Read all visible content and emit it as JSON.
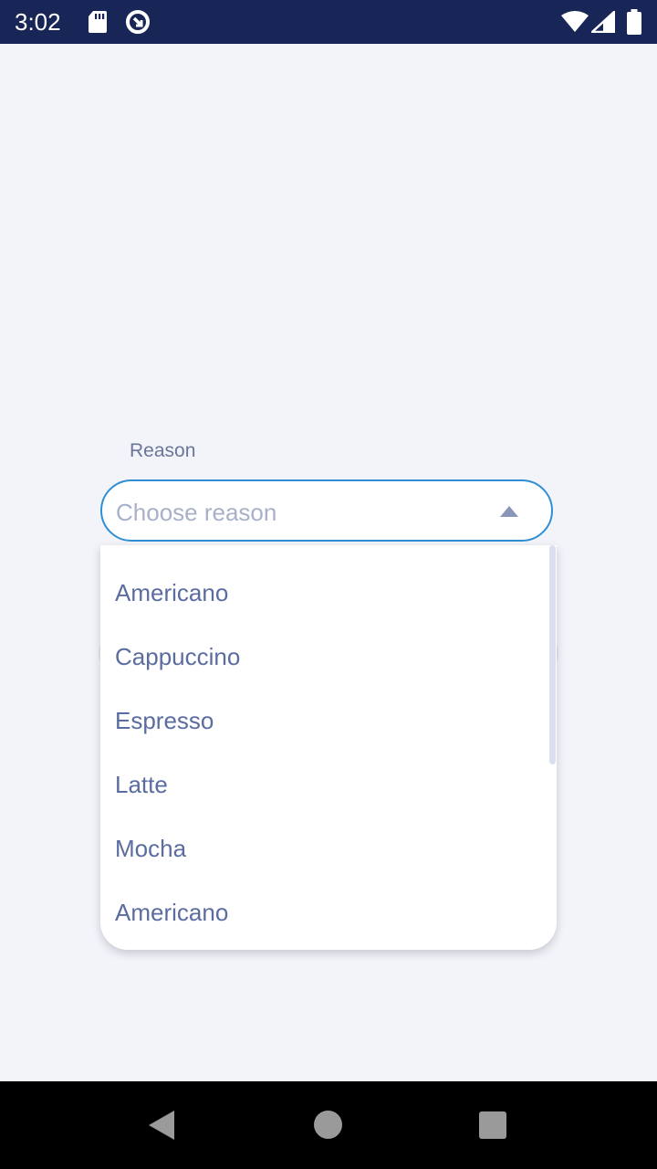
{
  "status_bar": {
    "time": "3:02",
    "icons_left": [
      "sd-card-icon",
      "data-saver-icon"
    ],
    "icons_right": [
      "wifi-icon",
      "cellular-signal-icon",
      "battery-icon"
    ],
    "background": "#182657"
  },
  "form": {
    "reason_label": "Reason",
    "reason_select": {
      "placeholder": "Choose reason",
      "expanded": true,
      "border_color": "#2f8fd6"
    },
    "options": [
      "Americano",
      "Cappuccino",
      "Espresso",
      "Latte",
      "Mocha",
      "Americano"
    ]
  },
  "nav_bar": {
    "buttons": [
      "back-icon",
      "home-icon",
      "recents-icon"
    ]
  }
}
